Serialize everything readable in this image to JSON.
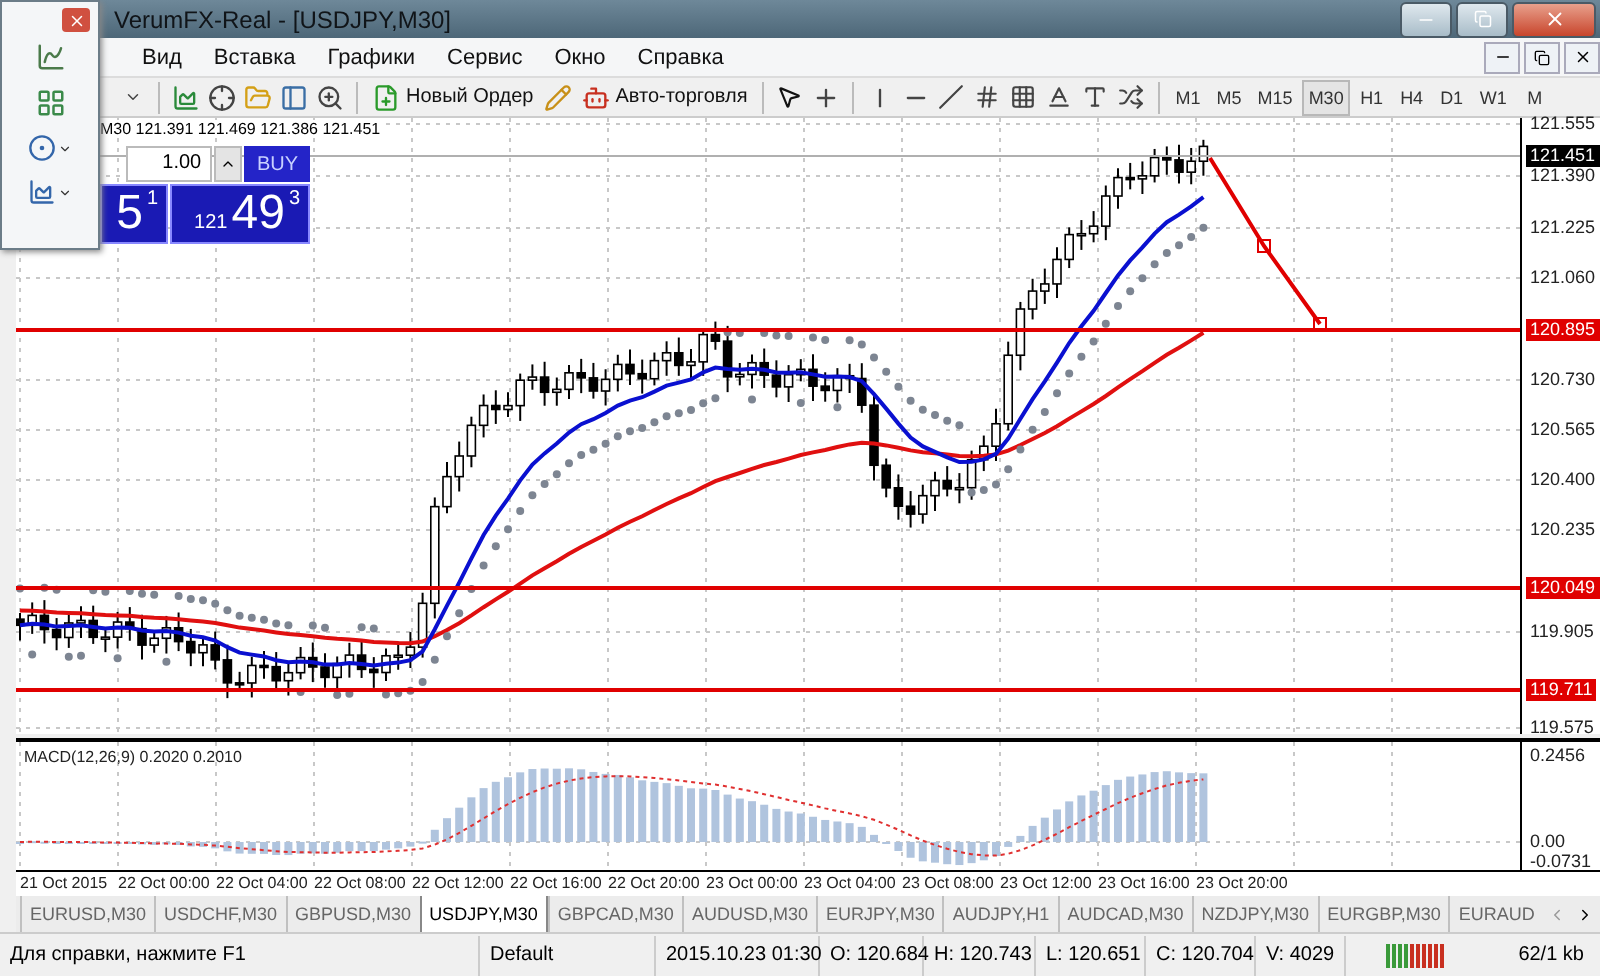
{
  "title_bar": {
    "title": "VerumFX-Real - [USDJPY,M30]"
  },
  "menu": [
    "Вид",
    "Вставка",
    "Графики",
    "Сервис",
    "Окно",
    "Справка"
  ],
  "toolbar": {
    "new_order": "Новый Ордер",
    "auto_trading": "Авто-торговля",
    "timeframes": [
      {
        "label": "M1",
        "selected": false
      },
      {
        "label": "M5",
        "selected": false
      },
      {
        "label": "M15",
        "selected": false
      },
      {
        "label": "M30",
        "selected": true
      },
      {
        "label": "H1",
        "selected": false
      },
      {
        "label": "H4",
        "selected": false
      },
      {
        "label": "D1",
        "selected": false
      },
      {
        "label": "W1",
        "selected": false
      },
      {
        "label": "M",
        "selected": false
      }
    ]
  },
  "chart": {
    "header": "M30  121.391 121.469 121.386 121.451",
    "one_click": {
      "lot": "1.00",
      "buy_label": "BUY",
      "sell_price": {
        "big": "5",
        "sup": "1"
      },
      "buy_price": {
        "prefix": "121",
        "big": "49",
        "sup": "3"
      }
    },
    "price_axis": [
      {
        "label": "121.555",
        "kind": "plain"
      },
      {
        "label": "121.451",
        "kind": "current"
      },
      {
        "label": "121.390",
        "kind": "plain"
      },
      {
        "label": "121.225",
        "kind": "plain"
      },
      {
        "label": "121.060",
        "kind": "plain"
      },
      {
        "label": "120.895",
        "kind": "level"
      },
      {
        "label": "120.730",
        "kind": "plain"
      },
      {
        "label": "120.565",
        "kind": "plain"
      },
      {
        "label": "120.400",
        "kind": "plain"
      },
      {
        "label": "120.235",
        "kind": "plain"
      },
      {
        "label": "120.049",
        "kind": "level"
      },
      {
        "label": "119.905",
        "kind": "plain"
      },
      {
        "label": "119.711",
        "kind": "level"
      },
      {
        "label": "119.575",
        "kind": "plain"
      }
    ],
    "macd": {
      "title": "MACD(12,26,9) 0.2020 0.2010",
      "axis": [
        "0.2456",
        "0.00",
        "-0.0731"
      ]
    },
    "time_axis": [
      "21 Oct 2015",
      "22 Oct 00:00",
      "22 Oct 04:00",
      "22 Oct 08:00",
      "22 Oct 12:00",
      "22 Oct 16:00",
      "22 Oct 20:00",
      "23 Oct 00:00",
      "23 Oct 04:00",
      "23 Oct 08:00",
      "23 Oct 12:00",
      "23 Oct 16:00",
      "23 Oct 20:00"
    ]
  },
  "tabs": [
    {
      "label": "EURUSD,M30",
      "selected": false
    },
    {
      "label": "USDCHF,M30",
      "selected": false
    },
    {
      "label": "GBPUSD,M30",
      "selected": false
    },
    {
      "label": "USDJPY,M30",
      "selected": true
    },
    {
      "label": "GBPCAD,M30",
      "selected": false
    },
    {
      "label": "AUDUSD,M30",
      "selected": false
    },
    {
      "label": "EURJPY,M30",
      "selected": false
    },
    {
      "label": "AUDJPY,H1",
      "selected": false
    },
    {
      "label": "AUDCAD,M30",
      "selected": false
    },
    {
      "label": "NZDJPY,M30",
      "selected": false
    },
    {
      "label": "EURGBP,M30",
      "selected": false
    },
    {
      "label": "EURAUD",
      "selected": false
    }
  ],
  "status_bar": {
    "help": "Для справки, нажмите F1",
    "profile": "Default",
    "time": "2015.10.23 01:30",
    "open": "O: 120.684",
    "high": "H: 120.743",
    "low": "L: 120.651",
    "close": "C: 120.704",
    "volume": "V: 4029",
    "traffic": "62/1 kb"
  }
}
